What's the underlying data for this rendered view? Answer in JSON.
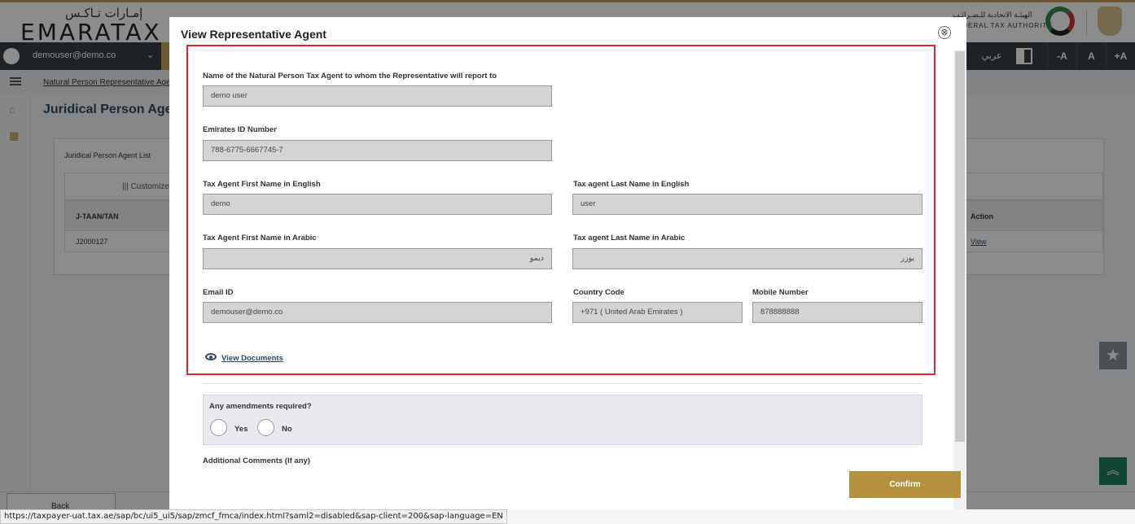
{
  "header": {
    "logo_ar": "إمـارات تـاكـس",
    "logo_en": "EMARATAX",
    "fta_ar": "الهيئـة الاتحادية للـضـرائـب",
    "fta_en": "FEDERAL TAX AUTHORITY"
  },
  "userbar": {
    "email": "demouser@demo.co",
    "chevron": "⌄",
    "language": "عربي",
    "font_decrease": "-A",
    "font_reset": "A",
    "font_increase": "+A"
  },
  "navbar": {
    "breadcrumb": "Natural Person Representative Agent"
  },
  "page": {
    "title": "Juridical Person Agent",
    "list_title": "Juridical Person Agent List",
    "customize_label": "|||  Customize",
    "table": {
      "headers": [
        "J-TAAN/TAN",
        "Action"
      ],
      "rows": [
        {
          "taan": "J2000127",
          "action": "View"
        }
      ]
    },
    "back_label": "Back"
  },
  "modal": {
    "title": "View Representative Agent",
    "close_icon": "⊗",
    "fields": {
      "agent_name": {
        "label": "Name of the Natural Person Tax Agent to whom the Representative will report to",
        "value": "demo user"
      },
      "emirates_id": {
        "label": "Emirates ID Number",
        "value": "788-6775-6667745-7"
      },
      "first_name_en": {
        "label": "Tax Agent First Name in English",
        "value": "demo"
      },
      "last_name_en": {
        "label": "Tax agent Last Name in English",
        "value": "user"
      },
      "first_name_ar": {
        "label": "Tax Agent First Name in Arabic",
        "value": "ديمو"
      },
      "last_name_ar": {
        "label": "Tax agent Last Name in Arabic",
        "value": "يوزر"
      },
      "email": {
        "label": "Email ID",
        "value": "demouser@demo.co"
      },
      "country_code": {
        "label": "Country Code",
        "value": "+971 ( United Arab Emirates )"
      },
      "mobile": {
        "label": "Mobile Number",
        "value": "878888888"
      }
    },
    "view_documents": "View Documents",
    "amendments": {
      "question": "Any amendments required?",
      "options": [
        "Yes",
        "No"
      ]
    },
    "comments_label": "Additional Comments (If any)",
    "confirm_label": "Confirm"
  },
  "statusbar": {
    "url": "https://taxpayer-uat.tax.ae/sap/bc/ui5_ui5/sap/zmcf_fmca/index.html?saml2=disabled&sap-client=200&sap-language=EN"
  },
  "colors": {
    "accent_gold": "#b5903f",
    "highlight_red": "#e3242b",
    "title_blue": "#2f4a62"
  }
}
